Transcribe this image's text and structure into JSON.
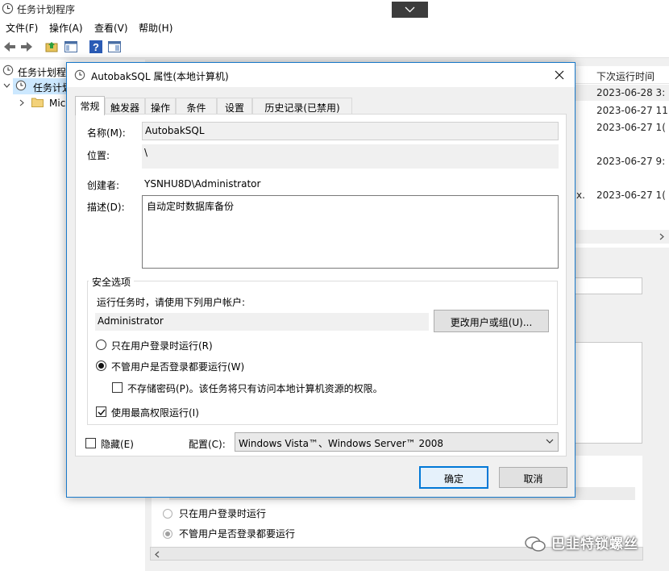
{
  "app": {
    "title": "任务计划程序",
    "menu": [
      "文件(F)",
      "操作(A)",
      "查看(V)",
      "帮助(H)"
    ]
  },
  "tree": {
    "items": [
      {
        "label": "任务计划程"
      },
      {
        "label": "任务计划"
      },
      {
        "label": "Mic"
      }
    ]
  },
  "list": {
    "header": "下次运行时间",
    "rows": [
      "2023-06-28 3:",
      "2023-06-27 11",
      "2023-06-27 1(",
      "2023-06-27 9:",
      "2023-06-27 1("
    ],
    "stray_char": "x."
  },
  "background_options": {
    "run_logged_on": "只在用户登录时运行",
    "run_whether": "不管用户是否登录都要运行"
  },
  "watermark": "巴韭特锁螺丝",
  "dialog": {
    "title": "AutobakSQL 属性(本地计算机)",
    "tabs": [
      "常规",
      "触发器",
      "操作",
      "条件",
      "设置",
      "历史记录(已禁用)"
    ],
    "active_tab": 0,
    "name_label": "名称(M):",
    "name_value": "AutobakSQL",
    "location_label": "位置:",
    "location_value": "\\",
    "author_label": "创建者:",
    "author_value": "YSNHU8D\\Administrator",
    "description_label": "描述(D):",
    "description_value": "自动定时数据库备份",
    "security": {
      "legend": "安全选项",
      "run_as_prompt": "运行任务时，请使用下列用户帐户:",
      "account": "Administrator",
      "change_user_button": "更改用户或组(U)...",
      "option_logged_on": "只在用户登录时运行(R)",
      "option_whether": "不管用户是否登录都要运行(W)",
      "option_whether_checked": true,
      "no_store_password": "不存储密码(P)。该任务将只有访问本地计算机资源的权限。",
      "no_store_password_checked": false,
      "highest_privileges": "使用最高权限运行(I)",
      "highest_privileges_checked": true
    },
    "hidden_label": "隐藏(E)",
    "hidden_checked": false,
    "config_label": "配置(C):",
    "config_value": "Windows Vista™、Windows Server™ 2008",
    "ok_button": "确定",
    "cancel_button": "取消"
  },
  "colors": {
    "accent": "#0078d7",
    "dialog_border": "#1979ca",
    "selection": "#cce8ff"
  }
}
